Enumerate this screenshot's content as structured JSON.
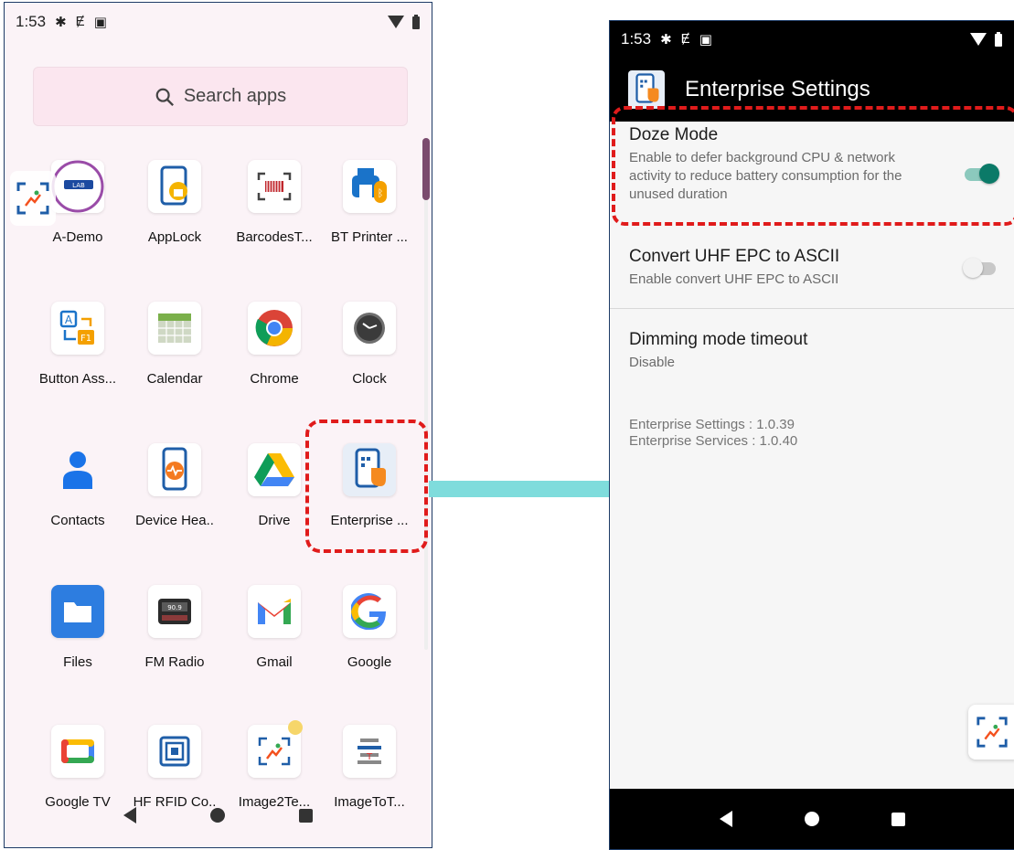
{
  "left": {
    "status": {
      "time": "1:53",
      "left_icons": [
        "gear-icon",
        "sync-icon",
        "screenshot-icon"
      ],
      "right_icons": [
        "wifi-icon",
        "battery-icon"
      ]
    },
    "search": {
      "label": "Search apps",
      "icon": "search-icon"
    },
    "apps": [
      {
        "label": "A-Demo",
        "icon": "cipherlab-demo-icon"
      },
      {
        "label": "AppLock",
        "icon": "applock-icon"
      },
      {
        "label": "BarcodesT...",
        "icon": "barcode-icon"
      },
      {
        "label": "BT Printer ...",
        "icon": "bt-printer-icon"
      },
      {
        "label": "Button Ass...",
        "icon": "button-assignment-icon"
      },
      {
        "label": "Calendar",
        "icon": "calendar-icon"
      },
      {
        "label": "Chrome",
        "icon": "chrome-icon"
      },
      {
        "label": "Clock",
        "icon": "clock-icon"
      },
      {
        "label": "Contacts",
        "icon": "contacts-icon"
      },
      {
        "label": "Device Hea..",
        "icon": "device-health-icon"
      },
      {
        "label": "Drive",
        "icon": "drive-icon"
      },
      {
        "label": "Enterprise ...",
        "icon": "enterprise-settings-icon"
      },
      {
        "label": "Files",
        "icon": "files-icon"
      },
      {
        "label": "FM Radio",
        "icon": "fm-radio-icon"
      },
      {
        "label": "Gmail",
        "icon": "gmail-icon"
      },
      {
        "label": "Google",
        "icon": "google-icon"
      },
      {
        "label": "Google TV",
        "icon": "google-tv-icon"
      },
      {
        "label": "HF RFID Co..",
        "icon": "hf-rfid-icon"
      },
      {
        "label": "Image2Te...",
        "icon": "image2text-icon"
      },
      {
        "label": "ImageToT...",
        "icon": "imagetotext-icon"
      }
    ]
  },
  "right": {
    "status": {
      "time": "1:53"
    },
    "title": "Enterprise Settings",
    "prefs": [
      {
        "title": "Doze Mode",
        "summary": "Enable to defer background CPU & network activity to reduce battery consumption for the unused duration",
        "toggle": true
      },
      {
        "title": "Convert UHF EPC to ASCII",
        "summary": "Enable convert UHF EPC to ASCII",
        "toggle": false
      },
      {
        "title": "Dimming mode timeout",
        "summary": "Disable"
      }
    ],
    "version_lines": [
      "Enterprise Settings : 1.0.39",
      "Enterprise Services : 1.0.40"
    ]
  },
  "colors": {
    "highlight": "#e01b1b",
    "arrow": "#7fdcdc",
    "toggle_on_thumb": "#0b7a68",
    "toggle_on_track": "#8cc9bd"
  }
}
